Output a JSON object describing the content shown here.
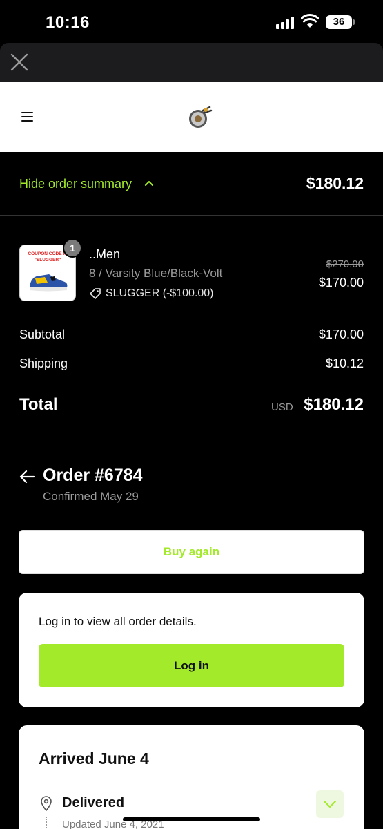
{
  "status_bar": {
    "time": "10:16",
    "battery": "36"
  },
  "header": {
    "menu_icon": "hamburger-icon",
    "logo": "store-logo"
  },
  "summary_toggle": {
    "label": "Hide order summary",
    "total": "$180.12"
  },
  "line_item": {
    "quantity": "1",
    "thumb_text": "COUPON CODE IS \"SLUGGER\"",
    "name": "..Men",
    "variant": "8 / Varsity Blue/Black-Volt",
    "discount": "SLUGGER (-$100.00)",
    "original_price": "$270.00",
    "price": "$170.00"
  },
  "totals": {
    "subtotal_label": "Subtotal",
    "subtotal_value": "$170.00",
    "shipping_label": "Shipping",
    "shipping_value": "$10.12",
    "total_label": "Total",
    "currency": "USD",
    "total_value": "$180.12"
  },
  "order": {
    "title": "Order #6784",
    "subtitle": "Confirmed May 29"
  },
  "buy_again": {
    "label": "Buy again"
  },
  "login_card": {
    "text": "Log in to view all order details.",
    "button_label": "Log in"
  },
  "shipment": {
    "title": "Arrived June 4",
    "status": "Delivered",
    "updated": "Updated June 4, 2021"
  },
  "colors": {
    "accent": "#a3ea2a",
    "background": "#000000",
    "card": "#ffffff"
  }
}
